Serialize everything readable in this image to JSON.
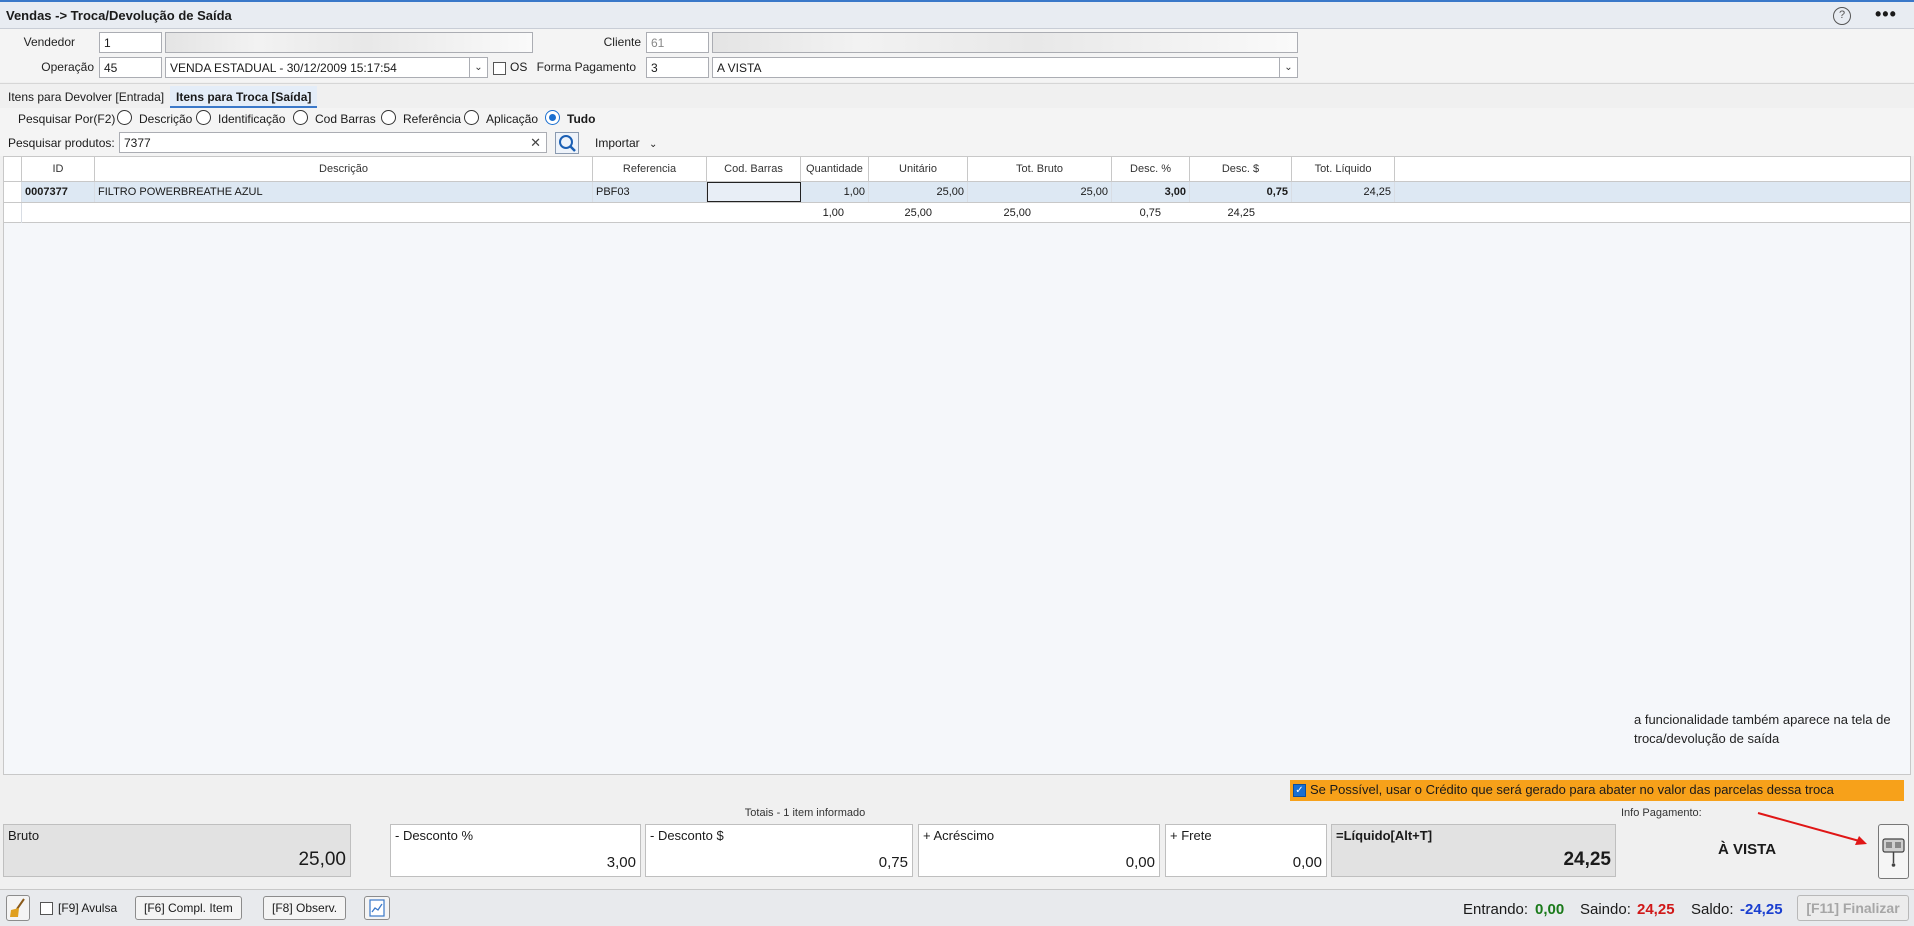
{
  "window": {
    "title": "Vendas -> Troca/Devolução de Saída",
    "help_glyph": "?",
    "more_glyph": "•••"
  },
  "header": {
    "vendedor_label": "Vendedor",
    "vendedor_code": "1",
    "cliente_label": "Cliente",
    "cliente_code": "61",
    "operacao_label": "Operação",
    "operacao_code": "45",
    "operacao_desc": "VENDA ESTADUAL - 30/12/2009 15:17:54",
    "os_label": "OS",
    "forma_pagamento_label": "Forma Pagamento",
    "forma_pagamento_code": "3",
    "forma_pagamento_desc": "A VISTA"
  },
  "tabs": [
    {
      "label": "Itens para Devolver [Entrada]"
    },
    {
      "label": "Itens para Troca [Saída]"
    }
  ],
  "search": {
    "search_by_label": "Pesquisar Por(F2)",
    "options": [
      "Descrição",
      "Identificação",
      "Cod Barras",
      "Referência",
      "Aplicação",
      "Tudo"
    ],
    "selected": "Tudo",
    "products_label": "Pesquisar produtos:",
    "products_value": "7377",
    "import_label": "Importar"
  },
  "grid": {
    "columns": [
      "ID",
      "Descrição",
      "Referencia",
      "Cod. Barras",
      "Quantidade",
      "Unitário",
      "Tot. Bruto",
      "Desc. %",
      "Desc. $",
      "Tot. Líquido"
    ],
    "rows": [
      {
        "id": "0007377",
        "descricao": "FILTRO POWERBREATHE AZUL",
        "referencia": "PBF03",
        "cod_barras": "",
        "quantidade": "1,00",
        "unitario": "25,00",
        "tot_bruto": "25,00",
        "desc_pct": "3,00",
        "desc_val": "0,75",
        "tot_liquido": "24,25"
      }
    ],
    "summary": {
      "quantidade": "1,00",
      "unitario": "25,00",
      "tot_bruto": "25,00",
      "desc_val": "0,75",
      "tot_liquido": "24,25"
    }
  },
  "note": "a funcionalidade também aparece  na tela de troca/devolução de saída",
  "credit_option": "Se Possível, usar o Crédito que será gerado para abater no valor das parcelas dessa troca",
  "totals": {
    "title": "Totais - 1 item informado",
    "bruto_label": "Bruto",
    "bruto": "25,00",
    "desconto_pct_label": "- Desconto %",
    "desconto_pct": "3,00",
    "desconto_val_label": "- Desconto $",
    "desconto_val": "0,75",
    "acrescimo_label": "+ Acréscimo",
    "acrescimo": "0,00",
    "frete_label": "+ Frete",
    "frete": "0,00",
    "liquido_label": "=Líquido[Alt+T]",
    "liquido": "24,25",
    "info_pagamento_label": "Info Pagamento:",
    "info_pagamento": "À VISTA"
  },
  "footer": {
    "avulsa": "[F9] Avulsa",
    "compl_item": "[F6] Compl. Item",
    "observ": "[F8] Observ.",
    "entrando_label": "Entrando:",
    "entrando": "0,00",
    "saindo_label": "Saindo:",
    "saindo": "24,25",
    "saldo_label": "Saldo:",
    "saldo": "-24,25",
    "finalizar": "[F11] Finalizar"
  },
  "colors": {
    "accent": "#3a78c9",
    "credit_bar": "#f7a11a",
    "entrando": "#1a7a1a",
    "saindo": "#d01818",
    "saldo": "#1a3fd0"
  }
}
